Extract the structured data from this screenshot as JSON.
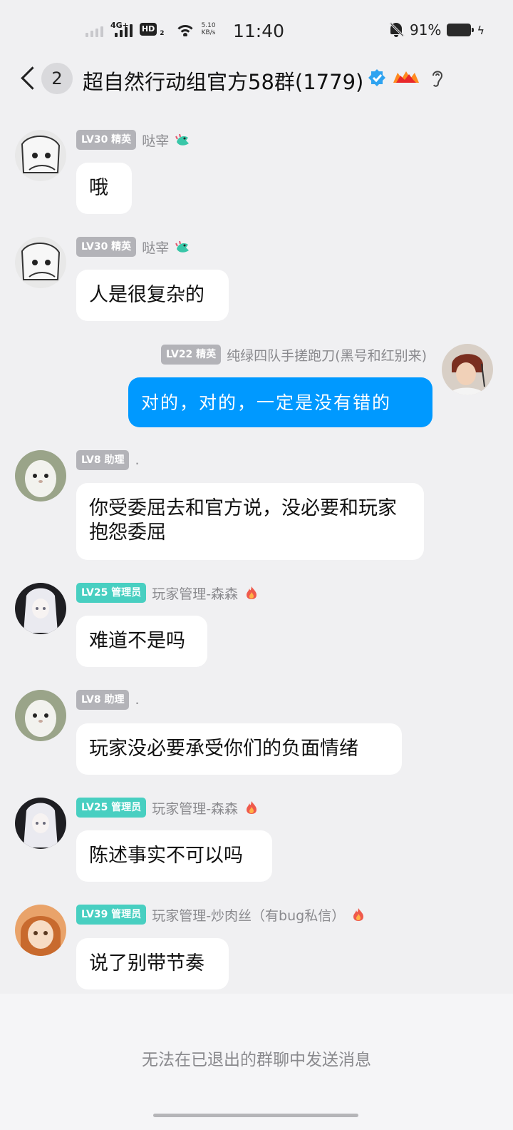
{
  "status_bar": {
    "network": "4G+",
    "hd": "HD",
    "hd_sub": "2",
    "speed_value": "5.10",
    "speed_unit": "KB/s",
    "time": "11:40",
    "battery": "91%",
    "icons": [
      "signal-icon",
      "wifi-icon",
      "mute-bell-icon",
      "battery-icon",
      "charging-icon"
    ]
  },
  "header": {
    "unread_count": "2",
    "title": "超自然行动组官方58群(1779)",
    "icons": [
      "back-chevron-icon",
      "verified-badge-icon",
      "vip-badge-icon",
      "ear-icon"
    ]
  },
  "messages": [
    {
      "badge": "LV30 精英",
      "nick": "哒宰",
      "text": "哦"
    },
    {
      "badge": "LV30 精英",
      "nick": "哒宰",
      "text": "人是很复杂的"
    },
    {
      "badge": "LV22 精英",
      "nick": "纯绿四队手搓跑刀(黑号和红别来)",
      "text": "对的，对的，一定是没有错的"
    },
    {
      "badge": "LV8 助理",
      "nick": ".",
      "text": "你受委屈去和官方说，没必要和玩家抱怨委屈"
    },
    {
      "badge": "LV25 管理员",
      "nick": "玩家管理-森森",
      "text": "难道不是吗"
    },
    {
      "badge": "LV8 助理",
      "nick": ".",
      "text": "玩家没必要承受你们的负面情绪"
    },
    {
      "badge": "LV25 管理员",
      "nick": "玩家管理-森森",
      "text": "陈述事实不可以吗"
    },
    {
      "badge": "LV39 管理员",
      "nick": "玩家管理-炒肉丝（有bug私信）",
      "text": "说了别带节奏"
    }
  ],
  "footer": {
    "notice": "无法在已退出的群聊中发送消息"
  },
  "colors": {
    "background": "#f0f0f2",
    "own_bubble": "#0099ff",
    "badge_member": "#b3b3b8",
    "badge_admin": "#48cfc1"
  }
}
